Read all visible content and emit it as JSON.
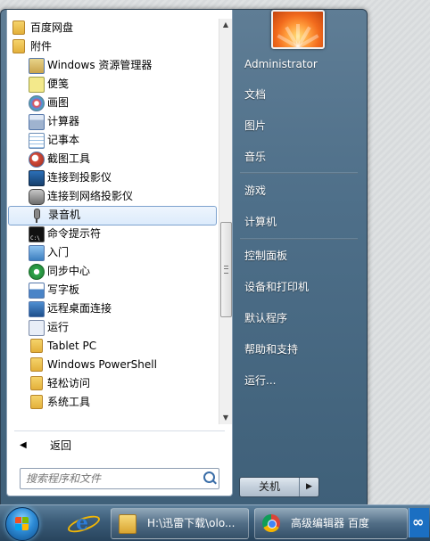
{
  "program_list": {
    "items": [
      {
        "label": "百度网盘",
        "icon": "folder-icon"
      },
      {
        "label": "附件",
        "icon": "folder-icon"
      },
      {
        "label": "Windows 资源管理器",
        "icon": "explorer-icon"
      },
      {
        "label": "便笺",
        "icon": "sticky-notes-icon"
      },
      {
        "label": "画图",
        "icon": "paint-icon"
      },
      {
        "label": "计算器",
        "icon": "calculator-icon"
      },
      {
        "label": "记事本",
        "icon": "notepad-icon"
      },
      {
        "label": "截图工具",
        "icon": "snipping-tool-icon"
      },
      {
        "label": "连接到投影仪",
        "icon": "projector-icon"
      },
      {
        "label": "连接到网络投影仪",
        "icon": "network-projector-icon"
      },
      {
        "label": "录音机",
        "icon": "microphone-icon"
      },
      {
        "label": "命令提示符",
        "icon": "command-prompt-icon"
      },
      {
        "label": "入门",
        "icon": "getting-started-icon"
      },
      {
        "label": "同步中心",
        "icon": "sync-center-icon"
      },
      {
        "label": "写字板",
        "icon": "wordpad-icon"
      },
      {
        "label": "远程桌面连接",
        "icon": "remote-desktop-icon"
      },
      {
        "label": "运行",
        "icon": "run-icon"
      },
      {
        "label": "Tablet PC",
        "icon": "folder-icon"
      },
      {
        "label": "Windows PowerShell",
        "icon": "folder-icon"
      },
      {
        "label": "轻松访问",
        "icon": "folder-icon"
      },
      {
        "label": "系统工具",
        "icon": "folder-icon"
      }
    ],
    "selected": "录音机"
  },
  "back_label": "返回",
  "search": {
    "placeholder": "搜索程序和文件"
  },
  "right_pane": {
    "items": [
      "Administrator",
      "文档",
      "图片",
      "音乐",
      "游戏",
      "计算机",
      "控制面板",
      "设备和打印机",
      "默认程序",
      "帮助和支持",
      "运行..."
    ]
  },
  "shutdown": {
    "label": "关机"
  },
  "taskbar": {
    "buttons": [
      {
        "label": "H:\\迅雷下载\\olo...",
        "icon": "folder-icon"
      },
      {
        "label": "高级编辑器 百度",
        "icon": "chrome-icon"
      }
    ]
  },
  "colors": {
    "selection": "#dcebfc",
    "menu_right": "#4e6f89",
    "taskbar": "#3b5c78"
  }
}
